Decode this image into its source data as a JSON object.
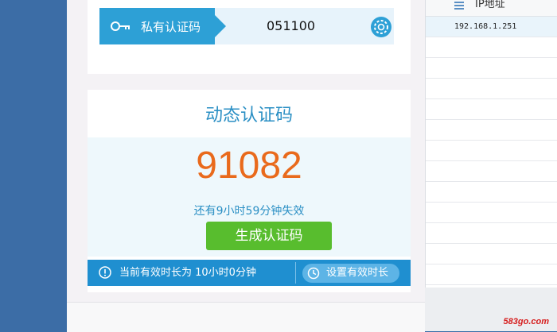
{
  "private_code": {
    "label": "私有认证码",
    "value": "051100",
    "key_icon": "key-icon",
    "settings_icon": "gear-icon"
  },
  "dynamic": {
    "title": "动态认证码",
    "code": "91082",
    "expiry_text": "还有9小时59分钟失效",
    "generate_label": "生成认证码"
  },
  "status_bar": {
    "text": "当前有效时长为 10小时0分钟",
    "set_label": "设置有效时长",
    "info_icon": "info-icon",
    "clock_icon": "clock-icon"
  },
  "table": {
    "column_header": "IP地址",
    "rows": [
      "192.168.1.251",
      "",
      "",
      "",
      "",
      "",
      "",
      "",
      "",
      "",
      "",
      "",
      ""
    ]
  },
  "watermark": "583go.com",
  "colors": {
    "accent_blue": "#2da0d6",
    "code_orange": "#e96a1c",
    "button_green": "#58bd2e",
    "status_blue": "#1f8fd0"
  }
}
